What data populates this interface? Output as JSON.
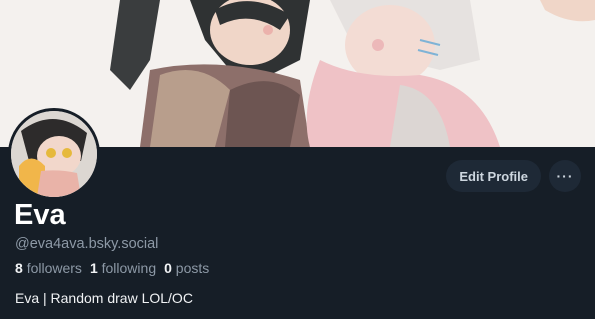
{
  "profile": {
    "display_name": "Eva",
    "handle": "@eva4ava.bsky.social",
    "bio": "Eva | Random draw LOL/OC"
  },
  "stats": {
    "followers_count": "8",
    "followers_label": "followers",
    "following_count": "1",
    "following_label": "following",
    "posts_count": "0",
    "posts_label": "posts"
  },
  "actions": {
    "edit_label": "Edit Profile",
    "more_label": "···"
  },
  "icons": {
    "more": "more-horizontal-icon"
  },
  "colors": {
    "background": "#161e27",
    "button_bg": "#1e2936",
    "muted_text": "#8d99a6"
  }
}
